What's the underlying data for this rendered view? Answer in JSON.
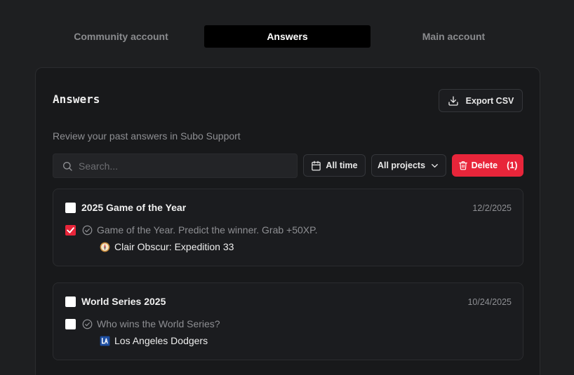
{
  "tabs": [
    {
      "label": "Community account",
      "active": false
    },
    {
      "label": "Answers",
      "active": true
    },
    {
      "label": "Main account",
      "active": false
    }
  ],
  "panel": {
    "title": "Answers",
    "subtitle": "Review your past answers in Subo Support",
    "export_label": "Export CSV"
  },
  "filters": {
    "search_placeholder": "Search...",
    "time_label": "All time",
    "projects_label": "All projects",
    "delete_label": "Delete",
    "delete_count": "(1)"
  },
  "answers": [
    {
      "title": "2025 Game of the Year",
      "date": "12/2/2025",
      "question": "Game of the Year. Predict the winner. Grab +50XP.",
      "answer": "Clair Obscur: Expedition 33",
      "answer_icon": "compass-emoji-icon",
      "title_checked": false,
      "answer_checked": true
    },
    {
      "title": "World Series 2025",
      "date": "10/24/2025",
      "question": "Who wins the World Series?",
      "answer": "Los Angeles Dodgers",
      "answer_icon": "dodgers-logo-icon",
      "title_checked": false,
      "answer_checked": false
    }
  ],
  "colors": {
    "background": "#1e1f21",
    "panel": "#18191b",
    "accent_red": "#e8253a",
    "active_tab": "#000000"
  }
}
